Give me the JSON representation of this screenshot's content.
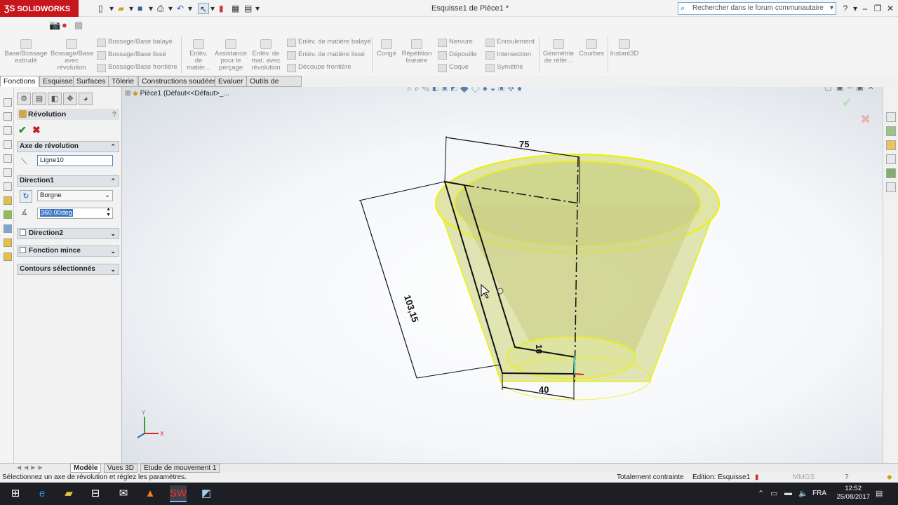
{
  "app": {
    "brand": "SOLIDWORKS",
    "doc_title": "Esquisse1 de Pièce1 *",
    "search_placeholder": "Rechercher dans le forum communautaire"
  },
  "commands": {
    "big": [
      {
        "id": "boss-extrude",
        "label": "Base/Bossage extrudé"
      },
      {
        "id": "boss-revolve",
        "label": "Bossage/Base avec révolution"
      },
      {
        "id": "cut-extrude",
        "label": "Enlèv. de matièr..."
      },
      {
        "id": "hole-wizard",
        "label": "Assistance pour le perçage"
      },
      {
        "id": "cut-revolve",
        "label": "Enlèv. de mat. avec révolution"
      },
      {
        "id": "fillet",
        "label": "Congé"
      },
      {
        "id": "linear-pattern",
        "label": "Répétition linéaire"
      },
      {
        "id": "ref-geometry",
        "label": "Géométrie de référ..."
      },
      {
        "id": "curves",
        "label": "Courbes"
      },
      {
        "id": "instant3d",
        "label": "Instant3D"
      }
    ],
    "small": [
      {
        "id": "swept-boss",
        "label": "Bossage/Base balayé"
      },
      {
        "id": "lofted-boss",
        "label": "Bossage/Base lissé"
      },
      {
        "id": "boundary-boss",
        "label": "Bossage/Base frontière"
      },
      {
        "id": "swept-cut",
        "label": "Enlèv. de matière balayé"
      },
      {
        "id": "lofted-cut",
        "label": "Enlèv. de matière lissé"
      },
      {
        "id": "boundary-cut",
        "label": "Découpe frontière"
      },
      {
        "id": "rib",
        "label": "Nervure"
      },
      {
        "id": "draft",
        "label": "Dépouille"
      },
      {
        "id": "shell",
        "label": "Coque"
      },
      {
        "id": "wrap",
        "label": "Enroulement"
      },
      {
        "id": "intersect",
        "label": "Intersection"
      },
      {
        "id": "mirror",
        "label": "Symétrie"
      }
    ]
  },
  "tabs": [
    "Fonctions",
    "Esquisse",
    "Surfaces",
    "Tôlerie",
    "Constructions soudées",
    "Evaluer",
    "Outils de rendu"
  ],
  "property_manager": {
    "title": "Révolution",
    "axis_section": "Axe de révolution",
    "axis_value": "Ligne10",
    "direction1_section": "Direction1",
    "type_value": "Borgne",
    "angle_value": "360.00deg",
    "direction2_label": "Direction2",
    "thin_feature_label": "Fonction mince",
    "selected_contours_label": "Contours sélectionnés"
  },
  "viewport": {
    "tree_root": "Pièce1  (Défaut<<Défaut>_...",
    "dimensions": {
      "top": "75",
      "side": "103,15",
      "thickness": "10",
      "bottom": "40"
    },
    "triad_labels": {
      "x": "X",
      "y": "Y"
    }
  },
  "bottom_tabs": [
    "Modèle",
    "Vues 3D",
    "Etude de mouvement 1"
  ],
  "status": {
    "message": "Sélectionnez un axe de révolution et réglez les paramètres.",
    "constraint": "Totalement contrainte",
    "edit": "Edition: Esquisse1",
    "units": "MMGS"
  },
  "taskbar": {
    "lang": "FRA",
    "time": "12:52",
    "date": "25/08/2017"
  },
  "colors": {
    "accent": "#c8161d",
    "model_fill": "#d6dc9a",
    "model_edge": "#f0f000",
    "ok_green": "#2e8b2e",
    "cancel_red": "#c0201f"
  }
}
